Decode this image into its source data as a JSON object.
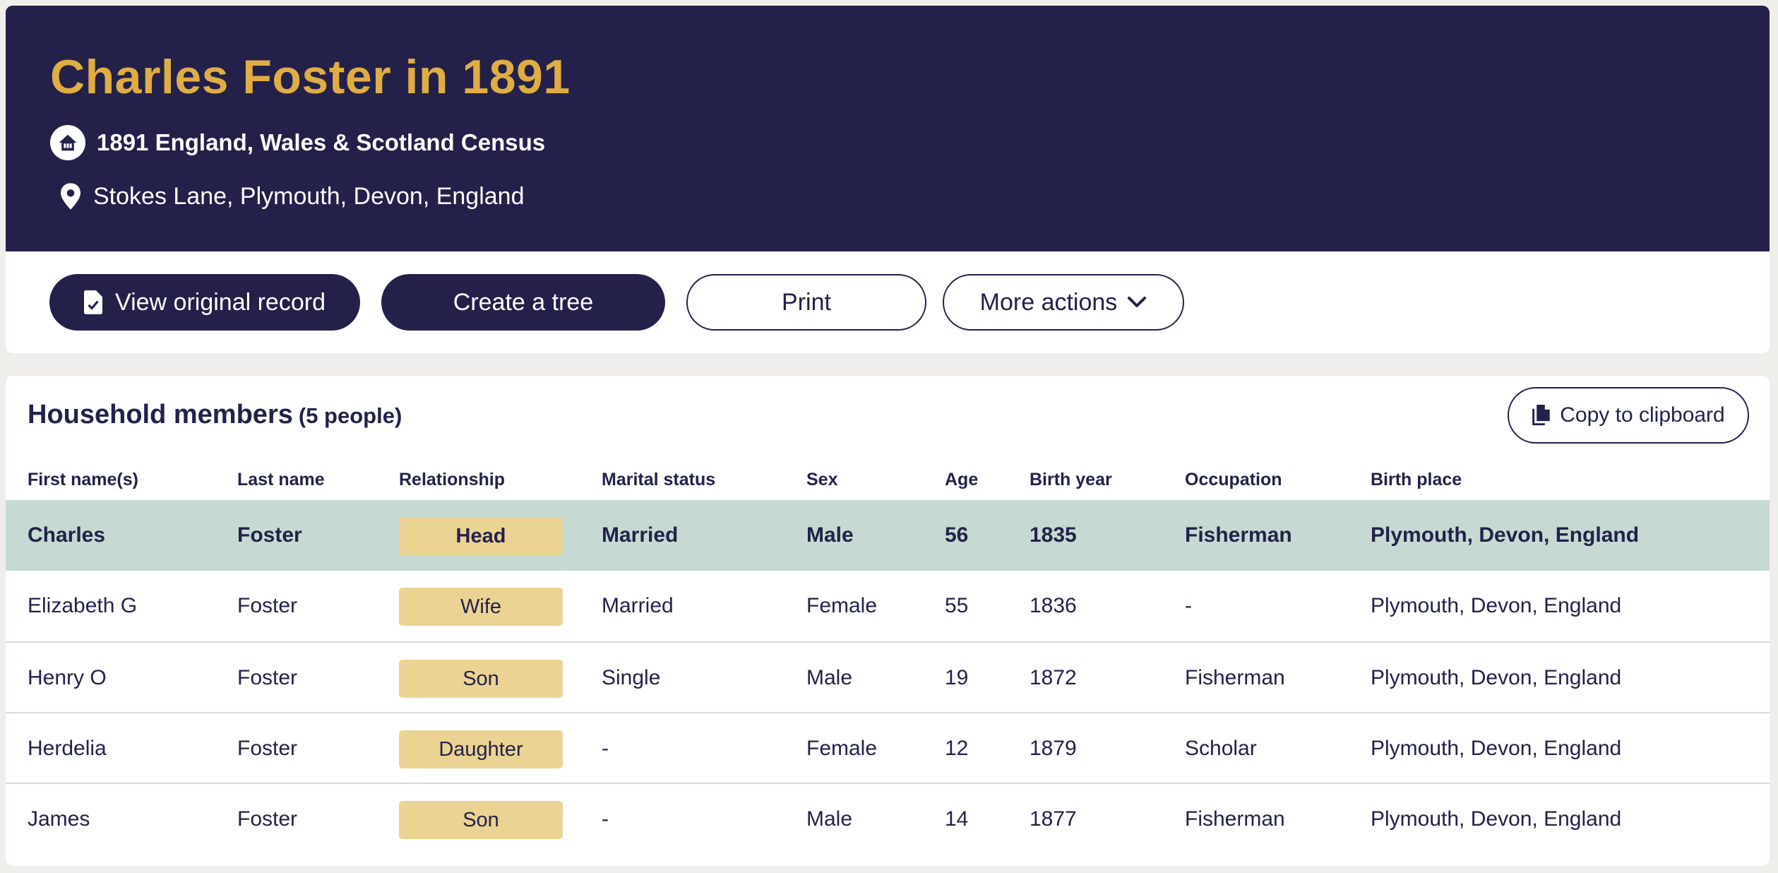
{
  "header": {
    "title": "Charles Foster in 1891",
    "census_name": "1891 England, Wales & Scotland Census",
    "location": "Stokes Lane, Plymouth, Devon, England",
    "title_color": "#e0ad45",
    "background_color": "#232149"
  },
  "actions": {
    "view_original": "View original record",
    "create_tree": "Create a tree",
    "print": "Print",
    "more_actions": "More actions"
  },
  "household": {
    "title": "Household members",
    "count": "(5 people)",
    "copy_label": "Copy to clipboard",
    "columns": [
      "First name(s)",
      "Last name",
      "Relationship",
      "Marital status",
      "Sex",
      "Age",
      "Birth year",
      "Occupation",
      "Birth place"
    ],
    "rows": [
      {
        "first": "Charles",
        "last": "Foster",
        "relationship": "Head",
        "marital": "Married",
        "sex": "Male",
        "age": "56",
        "birth_year": "1835",
        "occupation": "Fisherman",
        "birth_place": "Plymouth, Devon, England"
      },
      {
        "first": "Elizabeth G",
        "last": "Foster",
        "relationship": "Wife",
        "marital": "Married",
        "sex": "Female",
        "age": "55",
        "birth_year": "1836",
        "occupation": "-",
        "birth_place": "Plymouth, Devon, England"
      },
      {
        "first": "Henry O",
        "last": "Foster",
        "relationship": "Son",
        "marital": "Single",
        "sex": "Male",
        "age": "19",
        "birth_year": "1872",
        "occupation": "Fisherman",
        "birth_place": "Plymouth, Devon, England"
      },
      {
        "first": "Herdelia",
        "last": "Foster",
        "relationship": "Daughter",
        "marital": "-",
        "sex": "Female",
        "age": "12",
        "birth_year": "1879",
        "occupation": "Scholar",
        "birth_place": "Plymouth, Devon, England"
      },
      {
        "first": "James",
        "last": "Foster",
        "relationship": "Son",
        "marital": "-",
        "sex": "Male",
        "age": "14",
        "birth_year": "1877",
        "occupation": "Fisherman",
        "birth_place": "Plymouth, Devon, England"
      }
    ],
    "badge_color": "#ebd393",
    "highlight_color": "#c6dad3"
  },
  "icons": {
    "census": "house-icon",
    "location": "map-pin-icon",
    "view_record": "document-icon",
    "more": "chevron-down-icon",
    "copy": "copy-icon"
  }
}
